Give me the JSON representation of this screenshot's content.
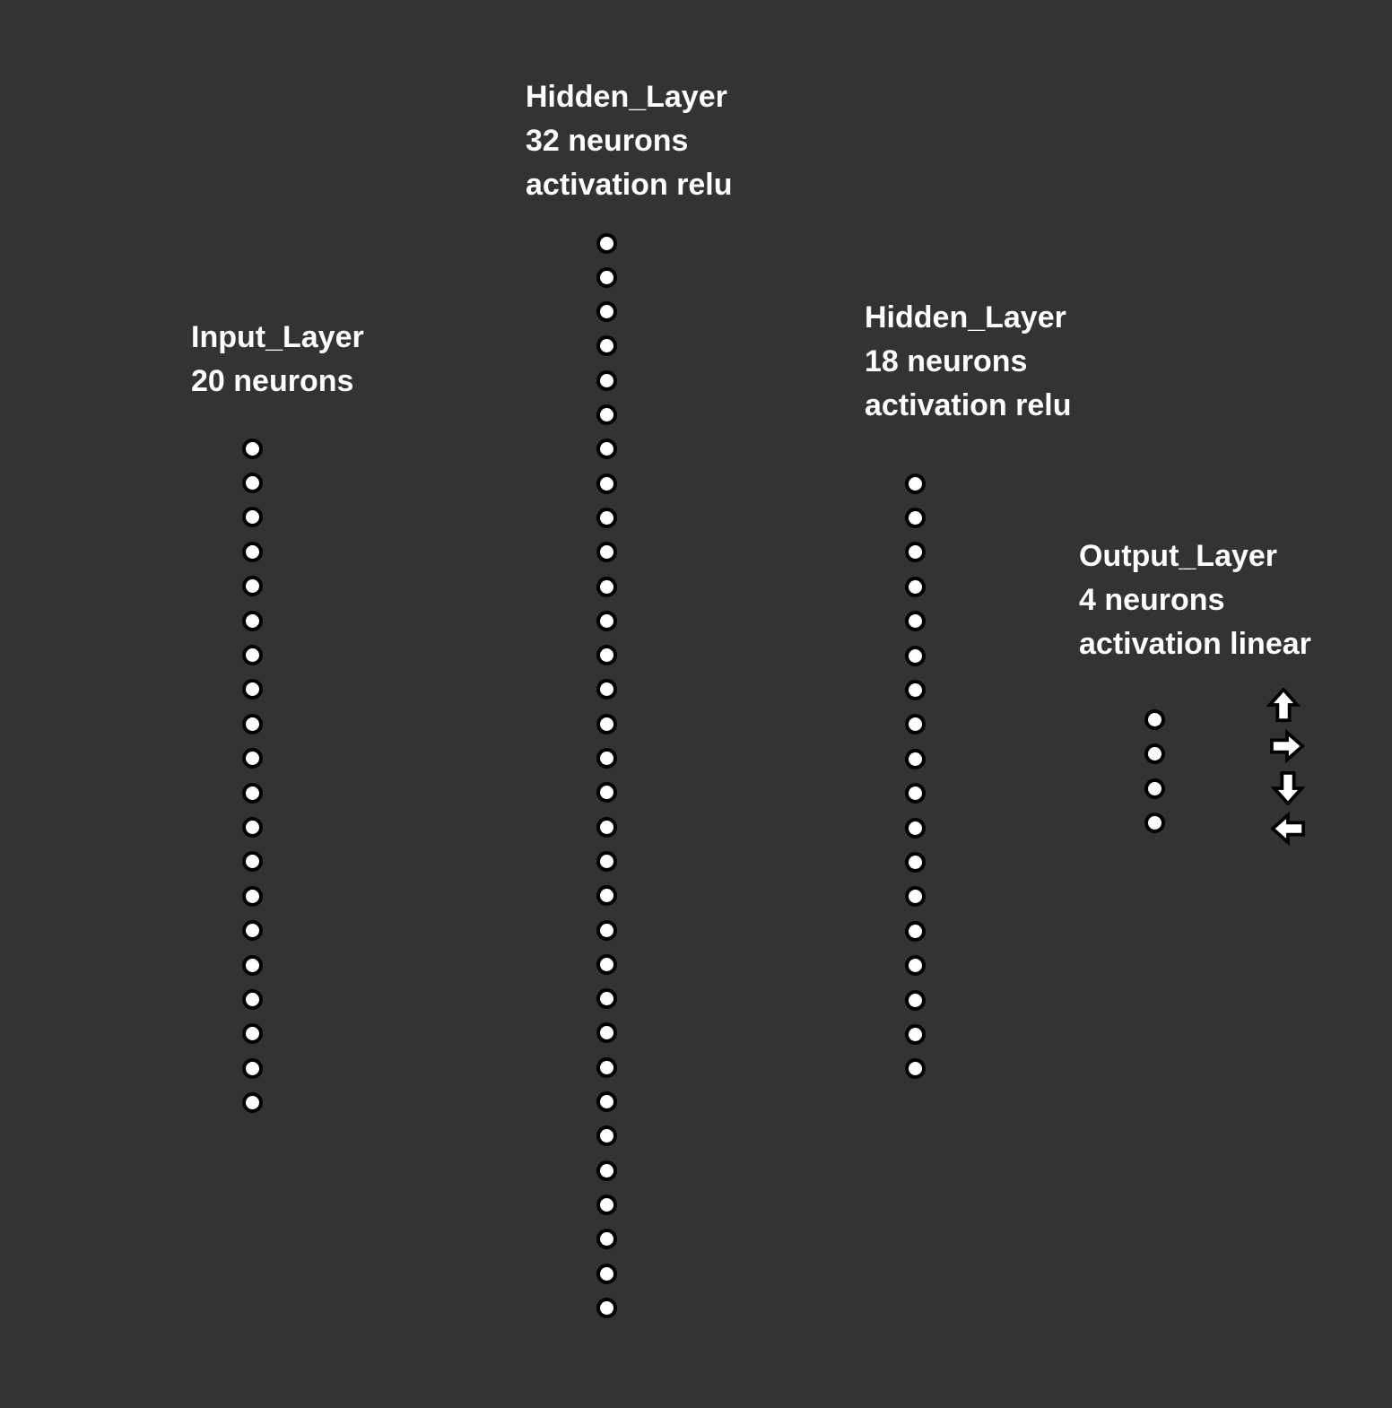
{
  "layers": [
    {
      "id": "input",
      "name": "Input_Layer",
      "neurons_label": "20 neurons",
      "activation_label": "",
      "neuron_count": 20
    },
    {
      "id": "hidden1",
      "name": "Hidden_Layer",
      "neurons_label": "32 neurons",
      "activation_label": "activation relu",
      "neuron_count": 32
    },
    {
      "id": "hidden2",
      "name": "Hidden_Layer",
      "neurons_label": "18 neurons",
      "activation_label": "activation relu",
      "neuron_count": 18
    },
    {
      "id": "output",
      "name": "Output_Layer",
      "neurons_label": "4 neurons",
      "activation_label": "activation linear",
      "neuron_count": 4
    }
  ],
  "output_actions": [
    "arrow-up-icon",
    "arrow-right-icon",
    "arrow-down-icon",
    "arrow-left-icon"
  ],
  "colors": {
    "background": "#333333",
    "text": "#ffffff",
    "neuron_fill": "#ffffff",
    "neuron_stroke": "#000000"
  }
}
